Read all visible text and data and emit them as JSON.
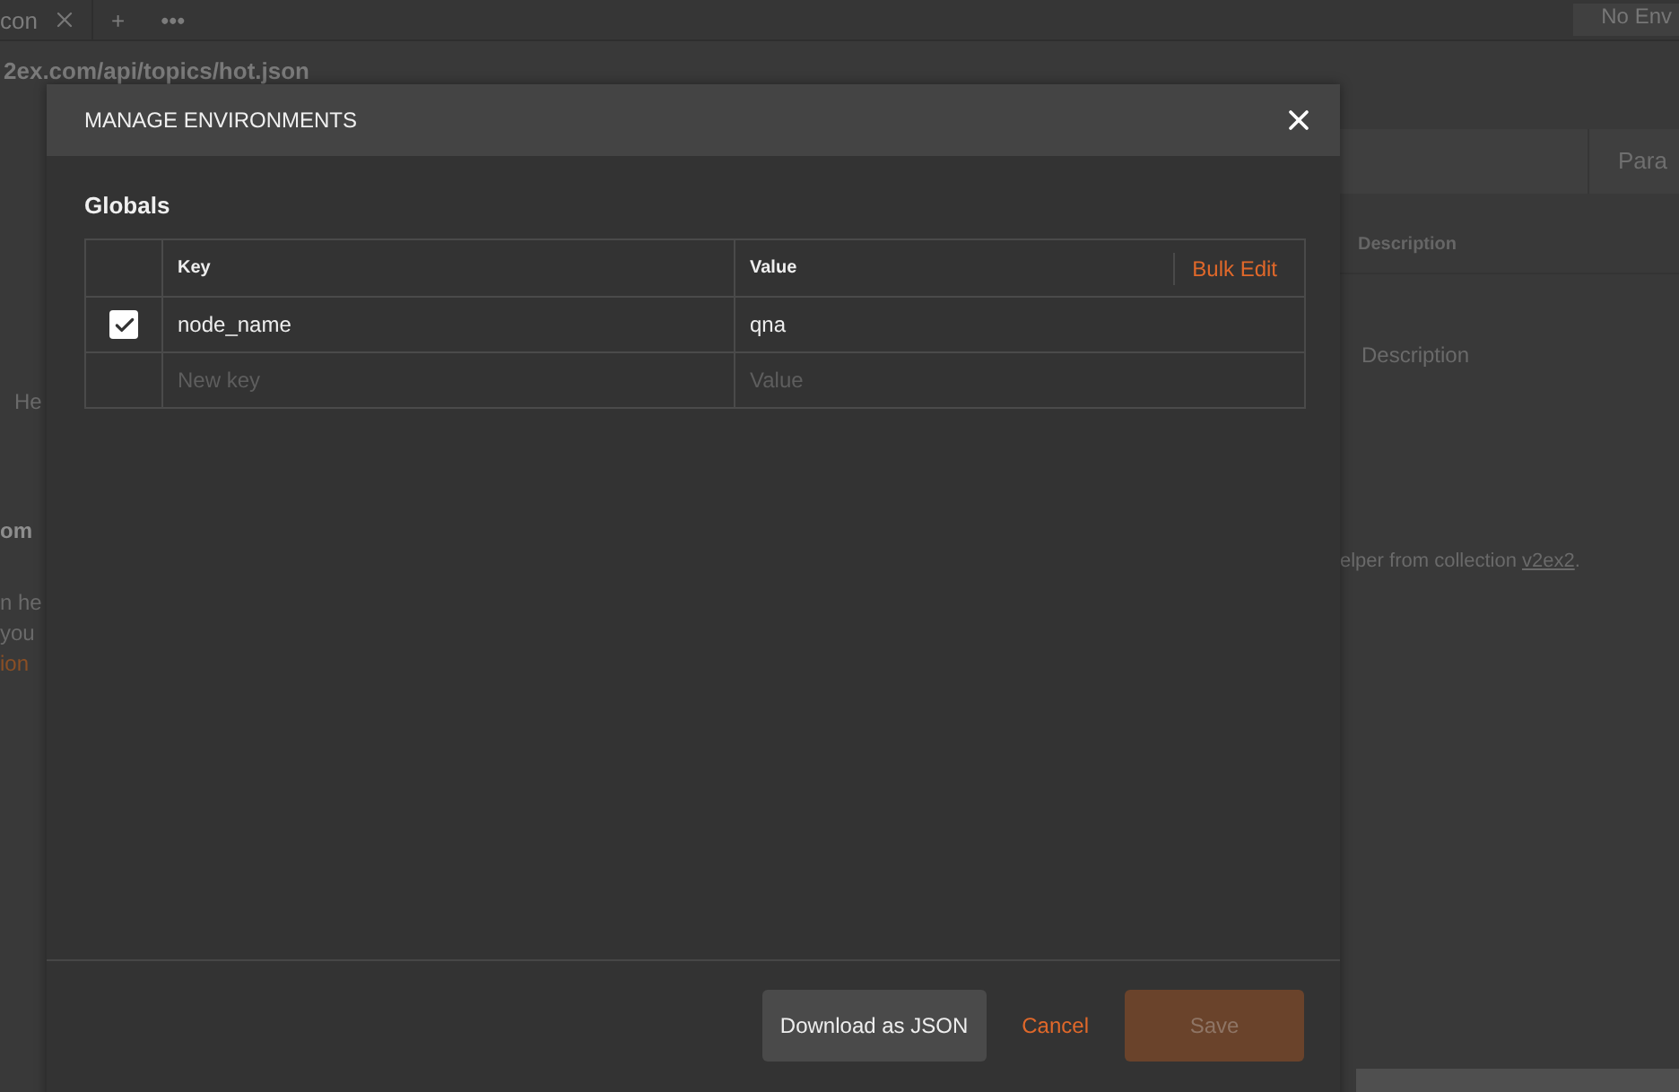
{
  "background": {
    "tab": {
      "label": "con"
    },
    "new_tab": "+",
    "more_tabs": "•••",
    "environment": "No Env",
    "url": "2ex.com/api/topics/hot.json",
    "param_tab": "Para",
    "description_header": "Description",
    "description_placeholder": "Description",
    "left_fragments": [
      {
        "kind": "tab",
        "text": "He"
      },
      {
        "kind": "section",
        "text": "om"
      },
      {
        "kind": "text",
        "text": "n he"
      },
      {
        "kind": "text",
        "text": "you"
      },
      {
        "kind": "link",
        "text": "ion"
      }
    ],
    "helper": {
      "text": "elper from collection ",
      "link": "v2ex2",
      "tail": "."
    }
  },
  "modal": {
    "title": "MANAGE ENVIRONMENTS",
    "section": "Globals",
    "columns": {
      "key": "Key",
      "value": "Value",
      "bulk_edit": "Bulk Edit"
    },
    "rows": [
      {
        "checked": true,
        "key": "node_name",
        "value": "qna"
      }
    ],
    "new_row": {
      "key_placeholder": "New key",
      "value_placeholder": "Value"
    },
    "buttons": {
      "download": "Download as JSON",
      "cancel": "Cancel",
      "save": "Save"
    }
  }
}
